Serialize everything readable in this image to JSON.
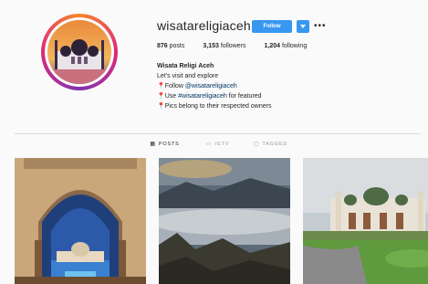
{
  "profile": {
    "username": "wisatareligiaceh",
    "follow_label": "Follow",
    "more_label": "•••",
    "stats": {
      "posts_count": "876",
      "posts_label": "posts",
      "followers_count": "3,153",
      "followers_label": "followers",
      "following_count": "1,204",
      "following_label": "following"
    },
    "bio": {
      "full_name": "Wisata Religi Aceh",
      "line1": "Let's visit and explore",
      "pin_icon": "📍",
      "line2_prefix": "Follow ",
      "line2_mention": "@wisatareligiaceh",
      "line3_prefix": "Use ",
      "line3_tag": "#wisatareligiaceh",
      "line3_suffix": " for featured",
      "line4": "Pics belong to their respected owners"
    }
  },
  "tabs": [
    {
      "label": "POSTS",
      "icon": "grid-icon",
      "glyph": "▦"
    },
    {
      "label": "IGTV",
      "icon": "tv-icon",
      "glyph": "▭"
    },
    {
      "label": "TAGGED",
      "icon": "tag-icon",
      "glyph": "▢"
    }
  ],
  "posts": [
    {
      "name": "mosque-arch-night"
    },
    {
      "name": "misty-mountain"
    },
    {
      "name": "mosque-green-field"
    }
  ],
  "colors": {
    "accent": "#3897f0",
    "text": "#262626",
    "muted": "#999999",
    "background": "#fafafa"
  }
}
